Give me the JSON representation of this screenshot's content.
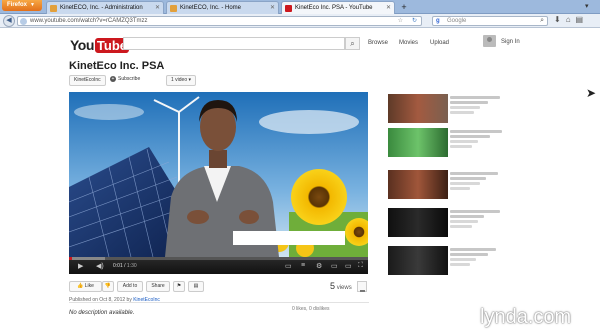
{
  "browser": {
    "app_button": "Firefox",
    "tabs": [
      {
        "label": "KinetECO, Inc. - Administration",
        "favicon_color": "#e2a03c"
      },
      {
        "label": "KinetECO, Inc. - Home",
        "favicon_color": "#e2a03c"
      },
      {
        "label": "KinetEco Inc. PSA - YouTube",
        "favicon_color": "#cc181e"
      }
    ],
    "new_tab": "+",
    "url": "www.youtube.com/watch?v=rCAMZQ3Tmzz",
    "search_engine_letter": "g",
    "search_placeholder": "Google"
  },
  "youtube": {
    "logo_you": "You",
    "logo_tube": "Tube",
    "search_button_icon": "search-icon",
    "nav": [
      "Browse",
      "Movies",
      "Upload"
    ],
    "sign_in": "Sign In",
    "video_title": "KinetEco Inc. PSA",
    "channel_name": "KinetEcoInc",
    "subscribe_label": "Subscribe",
    "videos_label": "1 video",
    "player": {
      "current_time": "0:01",
      "duration": "1:30",
      "progress_fraction": 0.01,
      "buffered_fraction": 0.12
    },
    "actions": {
      "like": "Like",
      "add_to": "Add to",
      "share": "Share"
    },
    "views_count": "5",
    "views_label": "views",
    "published_prefix": "Published on Oct 8, 2012 by",
    "published_channel": "KinetEcoInc",
    "likes_text": "0 likes, 0 dislikes",
    "description": "No description available."
  },
  "watermark": "lynda.com"
}
